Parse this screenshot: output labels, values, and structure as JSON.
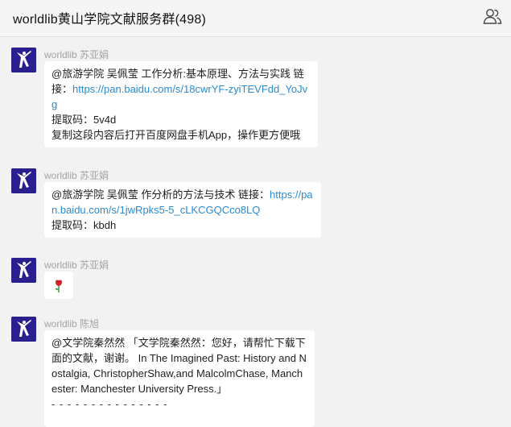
{
  "header": {
    "title": "worldlib黄山学院文献服务群(498)",
    "icon": "group-members-icon"
  },
  "messages": [
    {
      "sender": "worldlib 苏亚娟",
      "text1": "@旅游学院  吴佩莹  工作分析:基本原理、方法与实践 链接：",
      "link": "https://pan.baidu.com/s/18cwrYF-zyiTEVFdd_YoJvg",
      "line2": "提取码：5v4d",
      "line3": "复制这段内容后打开百度网盘手机App，操作更方便哦"
    },
    {
      "sender": "worldlib 苏亚娟",
      "text1": "@旅游学院  吴佩莹  作分析的方法与技术  链接：",
      "link": "https://pan.baidu.com/s/1jwRpks5-5_cLKCGQCco8LQ",
      "line2": "提取码：kbdh"
    },
    {
      "sender": "worldlib 苏亚娟",
      "emoji": "🌹",
      "emoji_name": "rose-emoji"
    },
    {
      "sender": "worldlib 陈旭",
      "text": "@文学院秦然然 「文学院秦然然：您好，请帮忙下载下面的文献，谢谢。 In The Imagined Past: History and Nostalgia, ChristopherShaw,and MalcolmChase, Manchester: Manchester University Press.」",
      "divider": "- - - - - - - - - - - - - - -"
    }
  ],
  "colors": {
    "background": "#f2f2f2",
    "bubble": "#ffffff",
    "link": "#2b8ad0",
    "sender": "#a3a3a3",
    "avatar": "#2a1f8f"
  }
}
